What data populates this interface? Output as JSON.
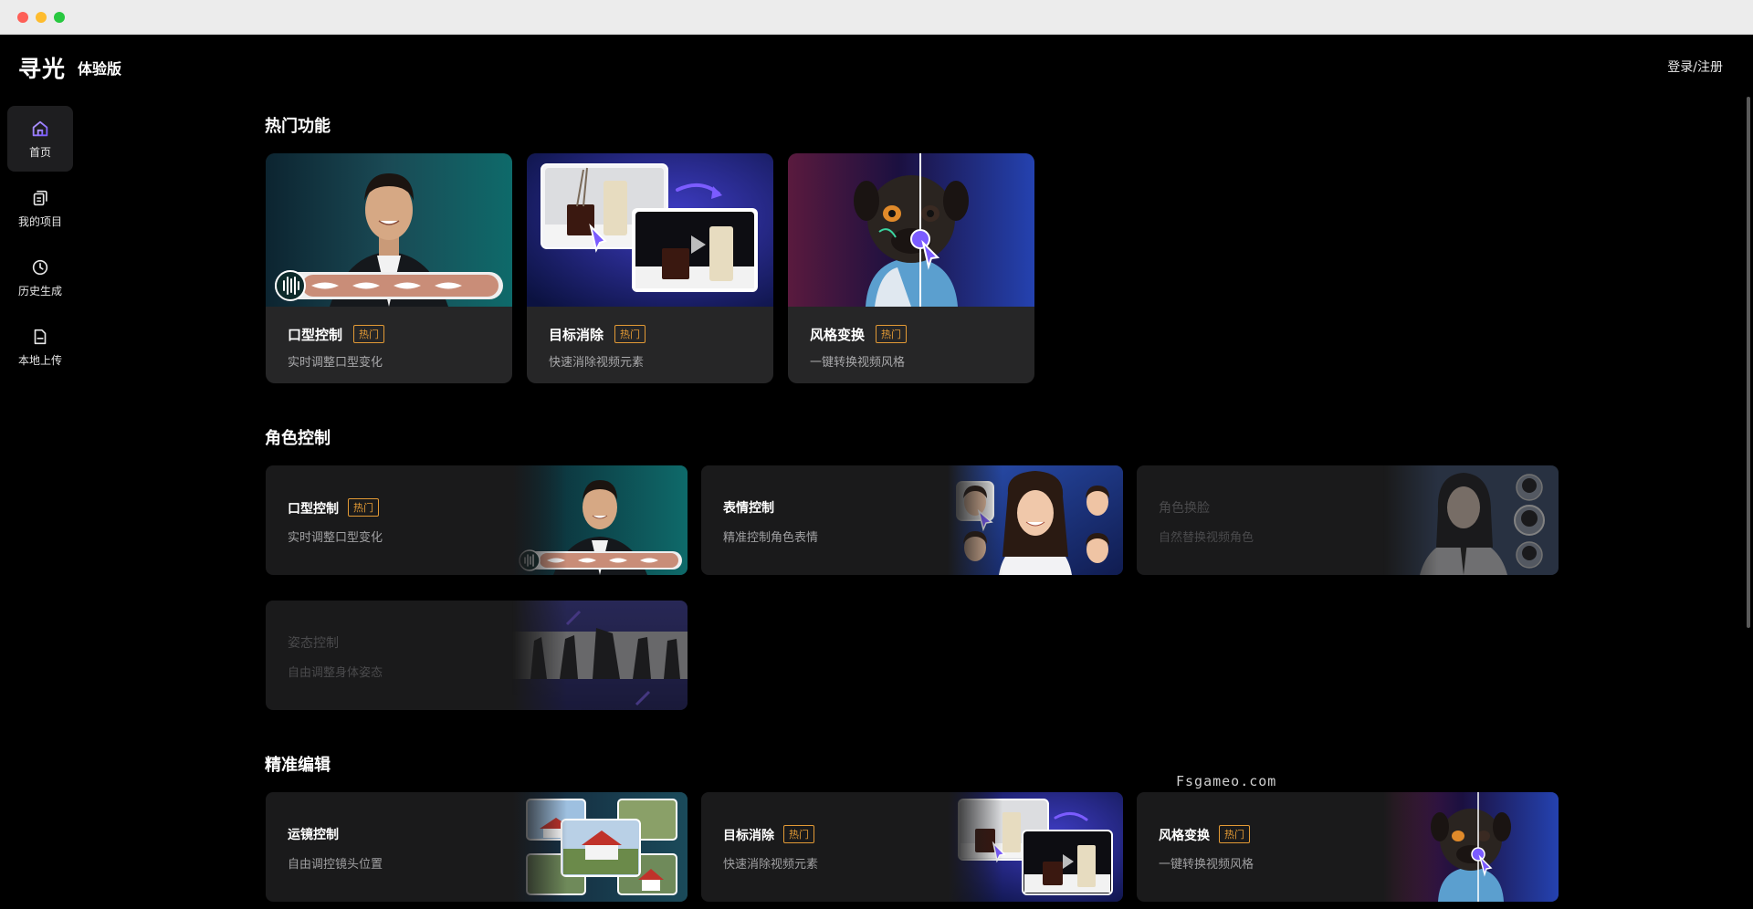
{
  "header": {
    "logo": "寻光",
    "edition": "体验版",
    "login": "登录/注册"
  },
  "sidebar": {
    "items": [
      {
        "label": "首页",
        "icon": "home-icon",
        "active": true
      },
      {
        "label": "我的项目",
        "icon": "projects-icon",
        "active": false
      },
      {
        "label": "历史生成",
        "icon": "clock-icon",
        "active": false
      },
      {
        "label": "本地上传",
        "icon": "upload-file-icon",
        "active": false
      }
    ]
  },
  "sections": {
    "hot": {
      "title": "热门功能",
      "cards": [
        {
          "title": "口型控制",
          "badge": "热门",
          "desc": "实时调整口型变化"
        },
        {
          "title": "目标消除",
          "badge": "热门",
          "desc": "快速消除视频元素"
        },
        {
          "title": "风格变换",
          "badge": "热门",
          "desc": "一键转换视频风格"
        }
      ]
    },
    "character": {
      "title": "角色控制",
      "cards": [
        {
          "title": "口型控制",
          "badge": "热门",
          "desc": "实时调整口型变化"
        },
        {
          "title": "表情控制",
          "desc": "精准控制角色表情"
        },
        {
          "title": "角色换脸",
          "desc": "自然替换视频角色"
        },
        {
          "title": "姿态控制",
          "desc": "自由调整身体姿态"
        }
      ]
    },
    "edit": {
      "title": "精准编辑",
      "cards": [
        {
          "title": "运镜控制",
          "desc": "自由调控镜头位置"
        },
        {
          "title": "目标消除",
          "badge": "热门",
          "desc": "快速消除视频元素"
        },
        {
          "title": "风格变换",
          "badge": "热门",
          "desc": "一键转换视频风格"
        }
      ]
    }
  },
  "watermark": "Fsgameo.com",
  "colors": {
    "badge": "#e39a35",
    "accent_purple": "#7b5cff",
    "card_bg": "#262627"
  }
}
